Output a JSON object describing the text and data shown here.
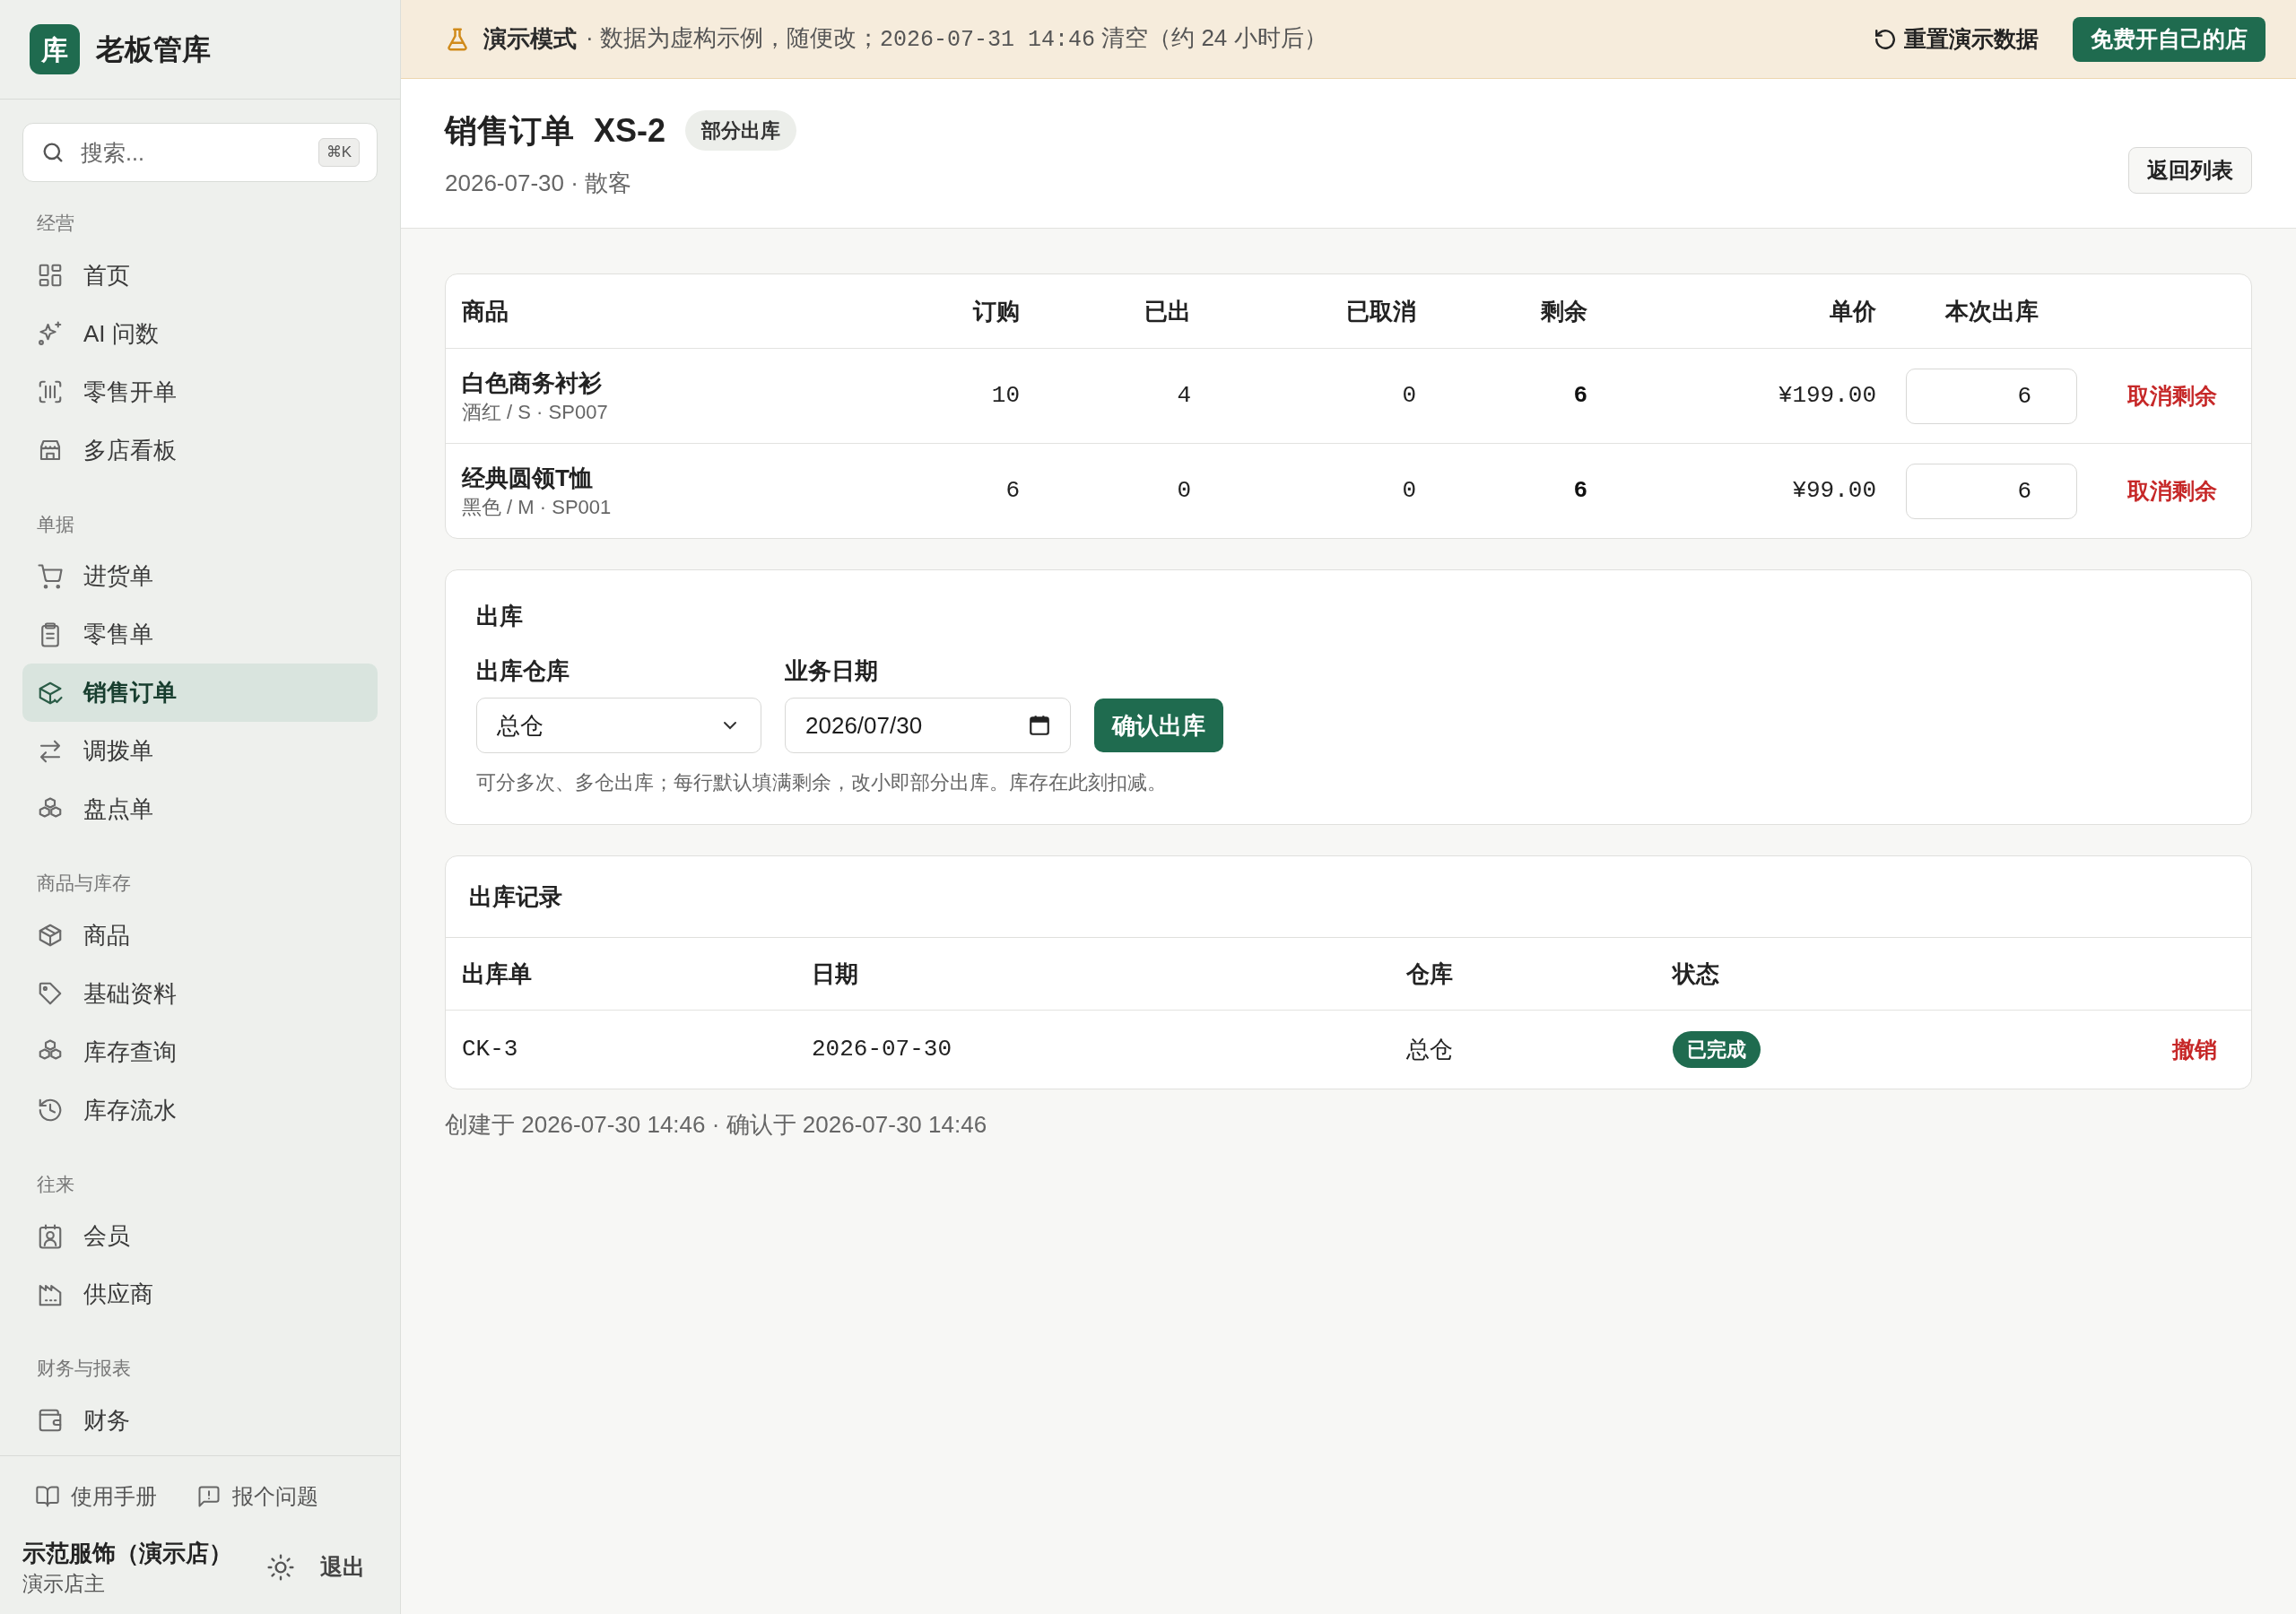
{
  "app": {
    "logo": "库",
    "name": "老板管库"
  },
  "search": {
    "placeholder": "搜索...",
    "shortcut": "⌘K"
  },
  "sidebar": {
    "sections": [
      {
        "label": "经营",
        "items": [
          {
            "label": "首页",
            "kind": "grid",
            "selected": false
          },
          {
            "label": "AI 问数",
            "kind": "sparkle",
            "selected": false
          },
          {
            "label": "零售开单",
            "kind": "scan",
            "selected": false
          },
          {
            "label": "多店看板",
            "kind": "store",
            "selected": false
          }
        ]
      },
      {
        "label": "单据",
        "items": [
          {
            "label": "进货单",
            "kind": "cart",
            "selected": false
          },
          {
            "label": "零售单",
            "kind": "clipboard",
            "selected": false
          },
          {
            "label": "销售订单",
            "kind": "package-check",
            "selected": true
          },
          {
            "label": "调拨单",
            "kind": "swap",
            "selected": false
          },
          {
            "label": "盘点单",
            "kind": "boxes",
            "selected": false
          }
        ]
      },
      {
        "label": "商品与库存",
        "items": [
          {
            "label": "商品",
            "kind": "package",
            "selected": false
          },
          {
            "label": "基础资料",
            "kind": "tag",
            "selected": false
          },
          {
            "label": "库存查询",
            "kind": "boxes",
            "selected": false
          },
          {
            "label": "库存流水",
            "kind": "history",
            "selected": false
          }
        ]
      },
      {
        "label": "往来",
        "items": [
          {
            "label": "会员",
            "kind": "contact",
            "selected": false
          },
          {
            "label": "供应商",
            "kind": "factory",
            "selected": false
          }
        ]
      },
      {
        "label": "财务与报表",
        "items": [
          {
            "label": "财务",
            "kind": "wallet",
            "selected": false
          }
        ]
      }
    ]
  },
  "sidebar_footer": {
    "links": [
      {
        "label": "使用手册",
        "kind": "book"
      },
      {
        "label": "报个问题",
        "kind": "message"
      }
    ],
    "store_name": "示范服饰（演示店）",
    "role": "演示店主",
    "logout": "退出"
  },
  "banner": {
    "mode": "演示模式",
    "message": "· 数据为虚构示例，随便改；",
    "time": "2026-07-31 14:46",
    "after": "清空（约 24 小时后）",
    "reset": "重置演示数据",
    "cta": "免费开自己的店"
  },
  "header": {
    "title": "销售订单",
    "number": "XS-2",
    "status": "部分出库",
    "meta": "2026-07-30 · 散客",
    "back": "返回列表"
  },
  "lines_table": {
    "columns": [
      "商品",
      "订购",
      "已出",
      "已取消",
      "剩余",
      "单价",
      "本次出库"
    ],
    "rows": [
      {
        "name": "白色商务衬衫",
        "spec": "酒红 / S · SP007",
        "ordered": "10",
        "shipped": "4",
        "cancelled": "0",
        "remaining": "6",
        "price": "¥199.00",
        "quantity": "6",
        "action": "取消剩余"
      },
      {
        "name": "经典圆领T恤",
        "spec": "黑色 / M · SP001",
        "ordered": "6",
        "shipped": "0",
        "cancelled": "0",
        "remaining": "6",
        "price": "¥99.00",
        "quantity": "6",
        "action": "取消剩余"
      }
    ]
  },
  "outbound": {
    "title": "出库",
    "warehouse_label": "出库仓库",
    "warehouse": "总仓",
    "date_label": "业务日期",
    "date": "2026/07/30",
    "confirm": "确认出库",
    "hint": "可分多次、多仓出库；每行默认填满剩余，改小即部分出库。库存在此刻扣减。"
  },
  "records": {
    "title": "出库记录",
    "columns": [
      "出库单",
      "日期",
      "仓库",
      "状态"
    ],
    "rows": [
      {
        "number": "CK-3",
        "date": "2026-07-30",
        "warehouse": "总仓",
        "status": "已完成",
        "action": "撤销"
      }
    ]
  },
  "footer_note": "创建于 2026-07-30 14:46 · 确认于 2026-07-30 14:46"
}
